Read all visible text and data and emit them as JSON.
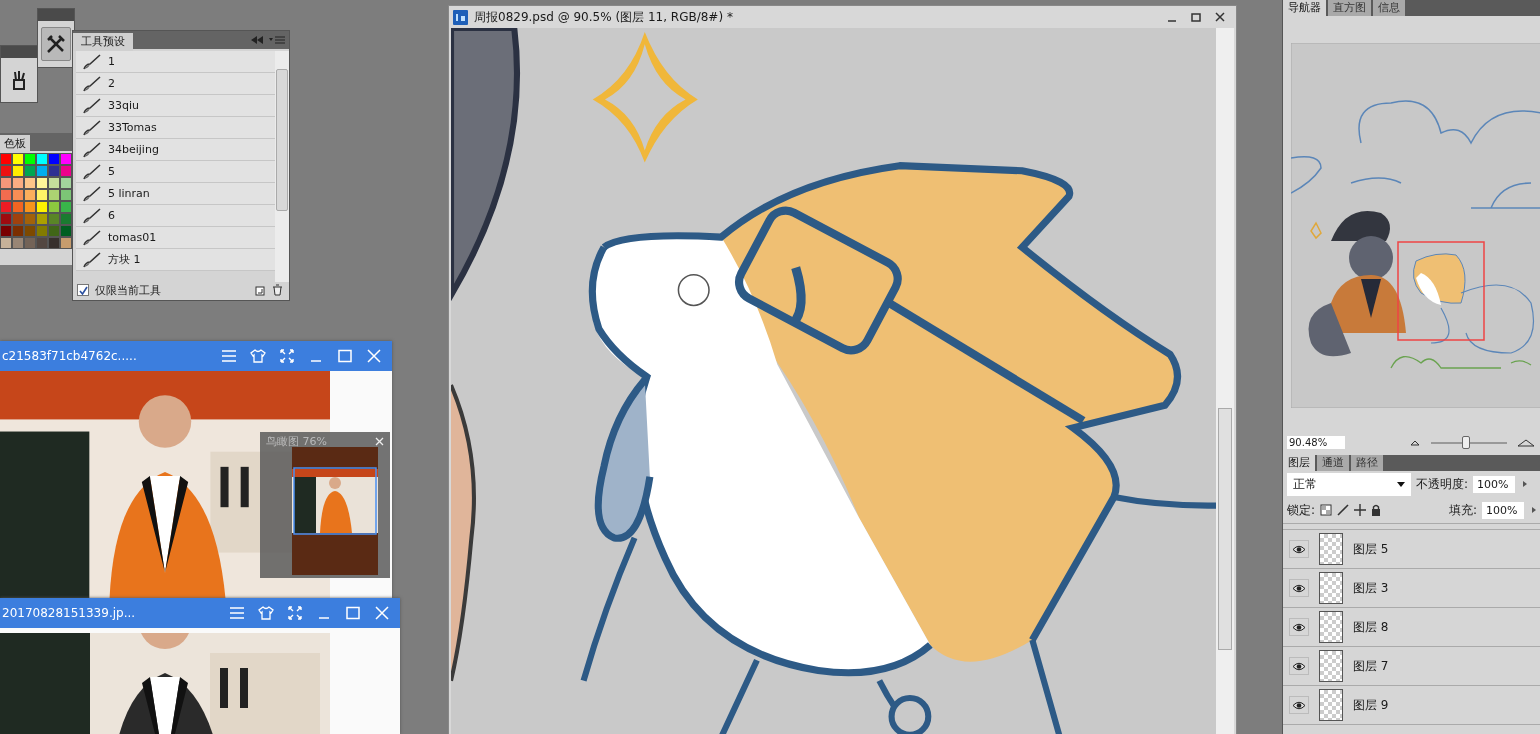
{
  "swatches": {
    "tab": "色板",
    "colors": [
      {
        "color": "#ff0000"
      },
      {
        "color": "#ffff00"
      },
      {
        "color": "#00ff00"
      },
      {
        "color": "#00ffff"
      },
      {
        "color": "#0000ff"
      },
      {
        "color": "#ff00ff"
      },
      {
        "color": "#ee1111"
      },
      {
        "color": "#ffee00"
      },
      {
        "color": "#00a651"
      },
      {
        "color": "#00aeef"
      },
      {
        "color": "#2e3192"
      },
      {
        "color": "#ec008c"
      },
      {
        "color": "#f7977a"
      },
      {
        "color": "#fbad82"
      },
      {
        "color": "#fdc689"
      },
      {
        "color": "#fff799"
      },
      {
        "color": "#c4df9b"
      },
      {
        "color": "#a3d39c"
      },
      {
        "color": "#f26c4f"
      },
      {
        "color": "#f68e55"
      },
      {
        "color": "#fbaf5c"
      },
      {
        "color": "#fff467"
      },
      {
        "color": "#acd372"
      },
      {
        "color": "#7cc576"
      },
      {
        "color": "#ed1c24"
      },
      {
        "color": "#f26522"
      },
      {
        "color": "#f7941d"
      },
      {
        "color": "#fff200"
      },
      {
        "color": "#8dc73f"
      },
      {
        "color": "#39b54a"
      },
      {
        "color": "#9e0b0f"
      },
      {
        "color": "#a0410d"
      },
      {
        "color": "#a36209"
      },
      {
        "color": "#aba000"
      },
      {
        "color": "#598527"
      },
      {
        "color": "#1a7b30"
      },
      {
        "color": "#790000"
      },
      {
        "color": "#7b2e00"
      },
      {
        "color": "#7d4900"
      },
      {
        "color": "#827b00"
      },
      {
        "color": "#406618"
      },
      {
        "color": "#005e20"
      },
      {
        "color": "#c7b299"
      },
      {
        "color": "#998675"
      },
      {
        "color": "#736357"
      },
      {
        "color": "#534741"
      },
      {
        "color": "#37302d"
      },
      {
        "color": "#c69c6d"
      }
    ]
  },
  "tool_presets": {
    "tab": "工具预设",
    "items": [
      {
        "name": "1"
      },
      {
        "name": "2"
      },
      {
        "name": "33qiu"
      },
      {
        "name": "33Tomas"
      },
      {
        "name": "34beijing"
      },
      {
        "name": "5"
      },
      {
        "name": "5 linran"
      },
      {
        "name": "6"
      },
      {
        "name": "tomas01"
      },
      {
        "name": "方块 1"
      }
    ],
    "current_tool_only": {
      "label": "仅限当前工具",
      "checked": true
    }
  },
  "viewer_windows": [
    {
      "title": "c21583f71cb4762c.....",
      "birdseye": {
        "title": "鸟瞰图 76%"
      }
    },
    {
      "title": "20170828151339.jp..."
    }
  ],
  "document": {
    "title": "周报0829.psd @ 90.5% (图层 11, RGB/8#) *"
  },
  "navigator": {
    "tabs": [
      {
        "label": "导航器",
        "selected": true
      },
      {
        "label": "直方图",
        "selected": false
      },
      {
        "label": "信息",
        "selected": false
      }
    ],
    "zoom": "90.48%",
    "zoom_slider": {
      "level": 0.45
    }
  },
  "layers": {
    "tabs": [
      {
        "label": "图层",
        "selected": true
      },
      {
        "label": "通道",
        "selected": false
      },
      {
        "label": "路径",
        "selected": false
      }
    ],
    "blend_mode": "正常",
    "opacity_label": "不透明度:",
    "opacity": "100%",
    "lock_label": "锁定:",
    "fill_label": "填充:",
    "fill": "100%",
    "items": [
      {
        "name": "图层 5",
        "visible": true
      },
      {
        "name": "图层 3",
        "visible": true
      },
      {
        "name": "图层 8",
        "visible": true
      },
      {
        "name": "图层 7",
        "visible": true
      },
      {
        "name": "图层 9",
        "visible": true
      }
    ]
  }
}
